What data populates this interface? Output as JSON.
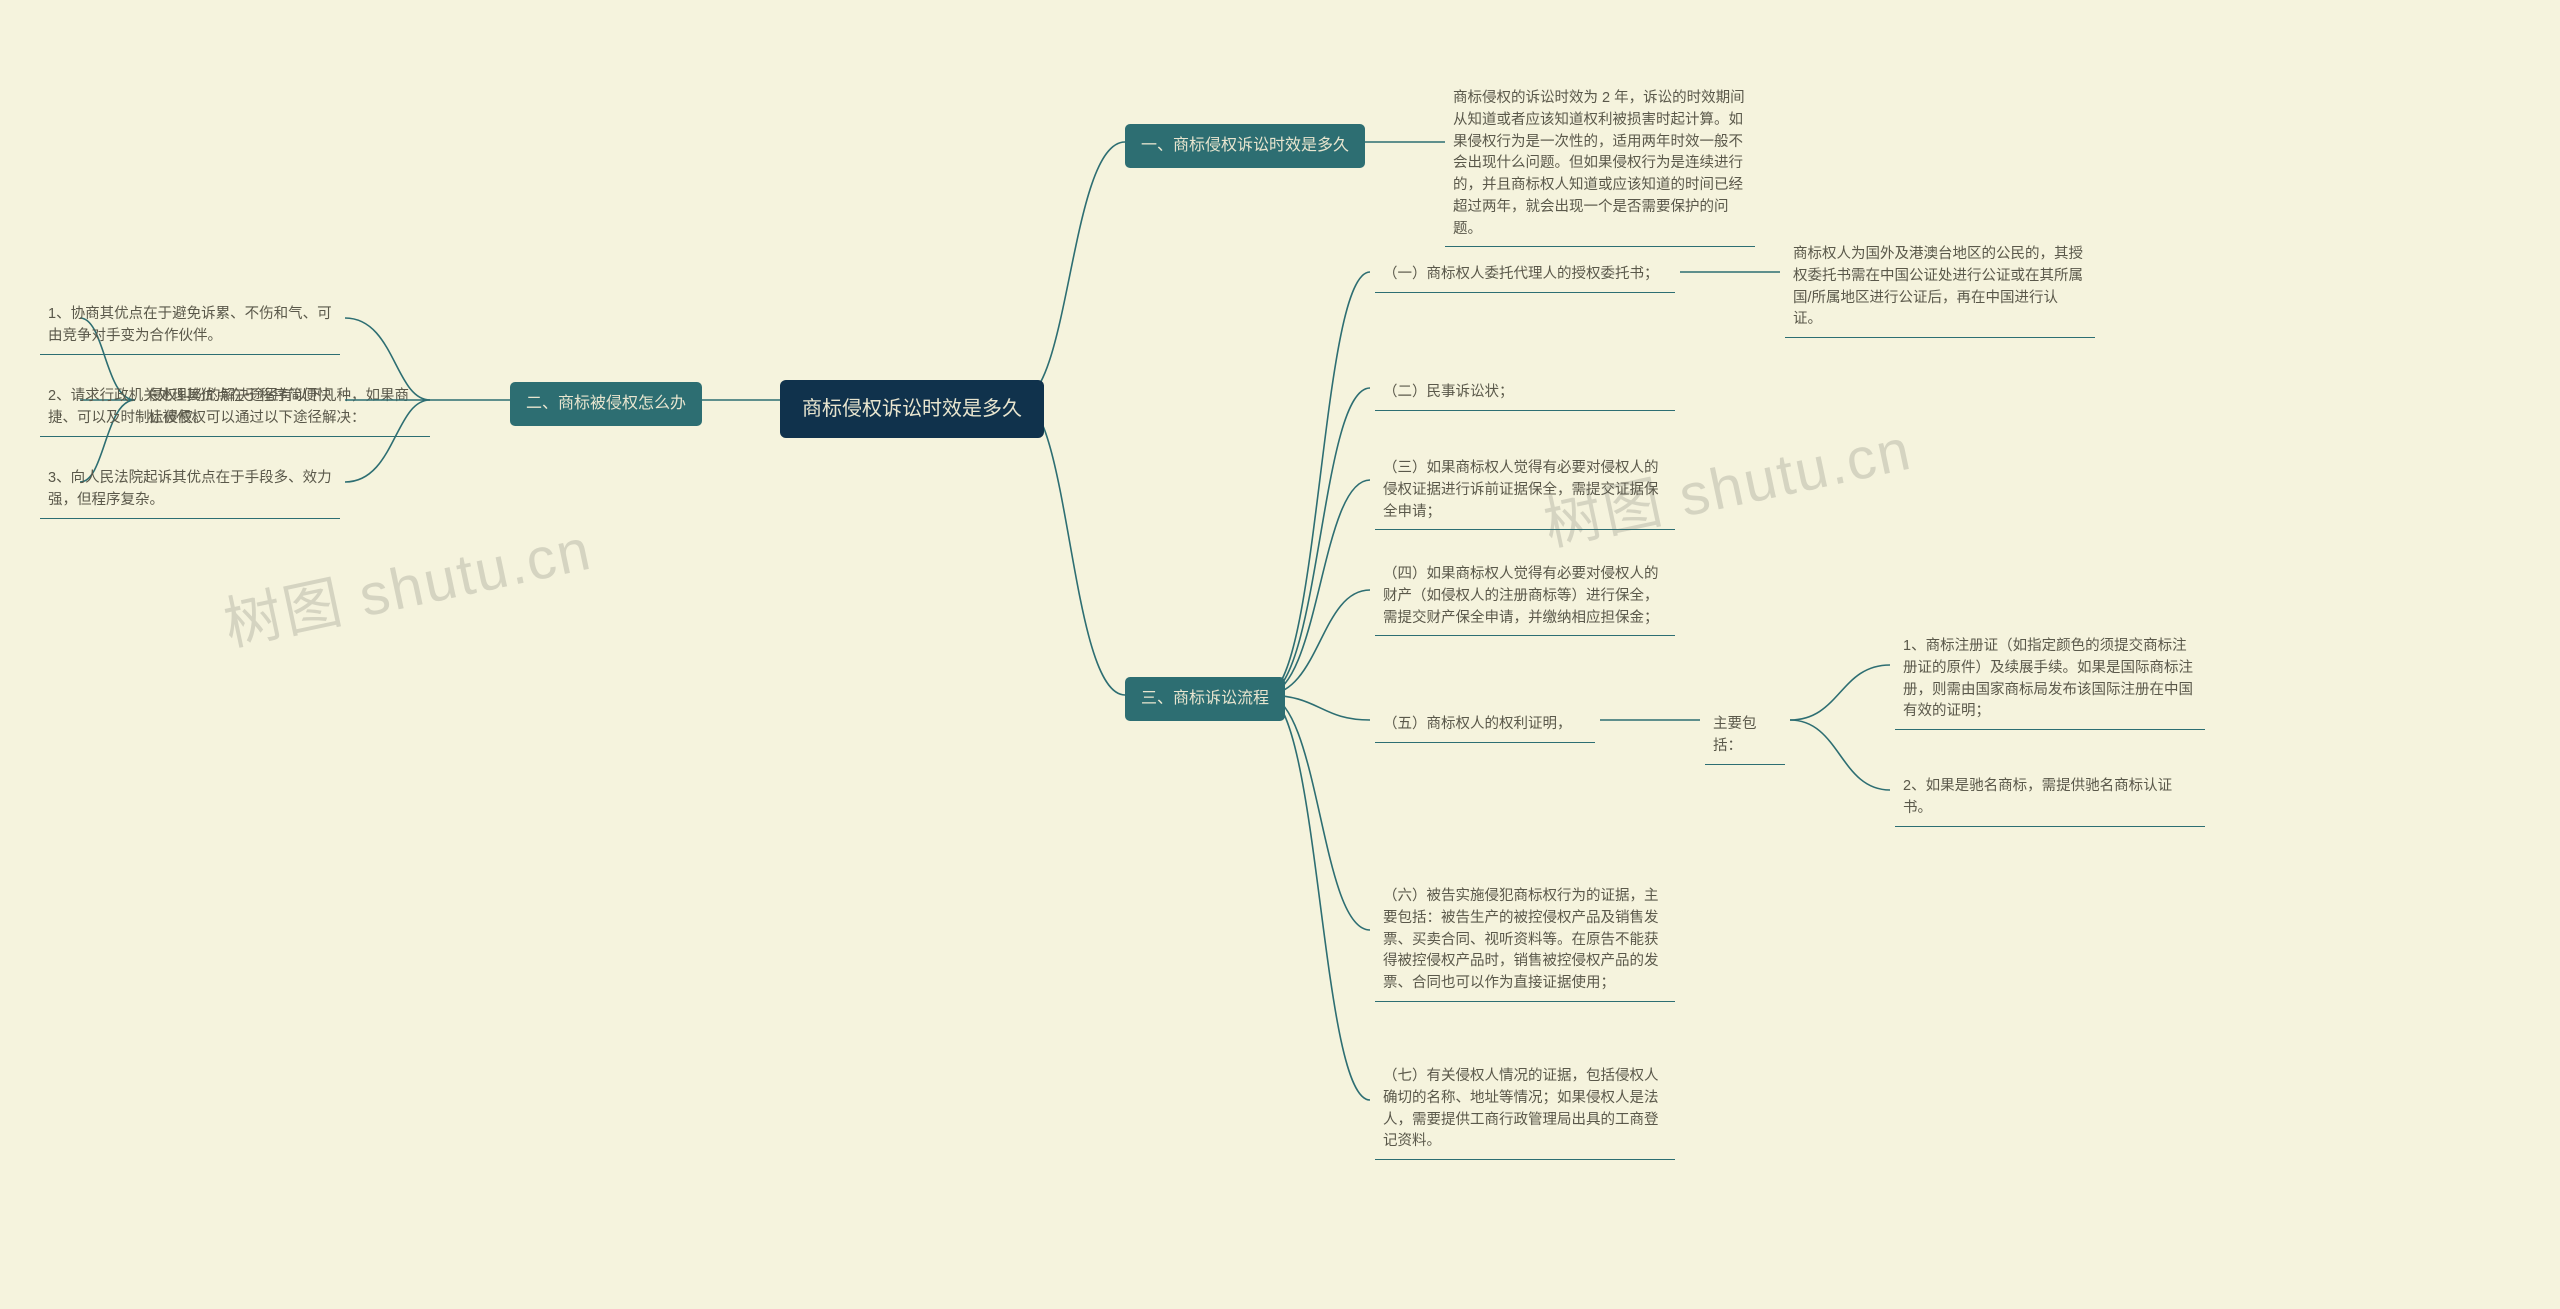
{
  "root": "商标侵权诉讼时效是多久",
  "watermarks": [
    "树图 shutu.cn",
    "树图 shutu.cn"
  ],
  "b1": {
    "title": "一、商标侵权诉讼时效是多久",
    "leaf": "商标侵权的诉讼时效为 2 年，诉讼的时效期间从知道或者应该知道权利被损害时起计算。如果侵权行为是一次性的，适用两年时效一般不会出现什么问题。但如果侵权行为是连续进行的，并且商标权人知道或应该知道的时间已经超过两年，就会出现一个是否需要保护的问题。"
  },
  "b2": {
    "title": "二、商标被侵权怎么办",
    "mid": "侵权纠纷的解决途径有以下几种，如果商标被侵权可以通过以下途径解决：",
    "leaf1": "1、协商其优点在于避免诉累、不伤和气、可由竞争对手变为合作伙伴。",
    "leaf2": "2、请求行政机关处理其优点在于程序简便快捷、可以及时制止侵权。",
    "leaf3": "3、向人民法院起诉其优点在于手段多、效力强，但程序复杂。"
  },
  "b3": {
    "title": "三、商标诉讼流程",
    "i1": {
      "text": "（一）商标权人委托代理人的授权委托书；",
      "leaf": "商标权人为国外及港澳台地区的公民的，其授权委托书需在中国公证处进行公证或在其所属国/所属地区进行公证后，再在中国进行认证。"
    },
    "i2": "（二）民事诉讼状；",
    "i3": "（三）如果商标权人觉得有必要对侵权人的侵权证据进行诉前证据保全，需提交证据保全申请；",
    "i4": "（四）如果商标权人觉得有必要对侵权人的财产（如侵权人的注册商标等）进行保全，需提交财产保全申请，并缴纳相应担保金；",
    "i5": {
      "text": "（五）商标权人的权利证明，",
      "mid": "主要包括：",
      "leaf1": "1、商标注册证（如指定颜色的须提交商标注册证的原件）及续展手续。如果是国际商标注册，则需由国家商标局发布该国际注册在中国有效的证明；",
      "leaf2": "2、如果是驰名商标，需提供驰名商标认证书。"
    },
    "i6": "（六）被告实施侵犯商标权行为的证据，主要包括：被告生产的被控侵权产品及销售发票、买卖合同、视听资料等。在原告不能获得被控侵权产品时，销售被控侵权产品的发票、合同也可以作为直接证据使用；",
    "i7": "（七）有关侵权人情况的证据，包括侵权人确切的名称、地址等情况；如果侵权人是法人，需要提供工商行政管理局出具的工商登记资料。"
  }
}
